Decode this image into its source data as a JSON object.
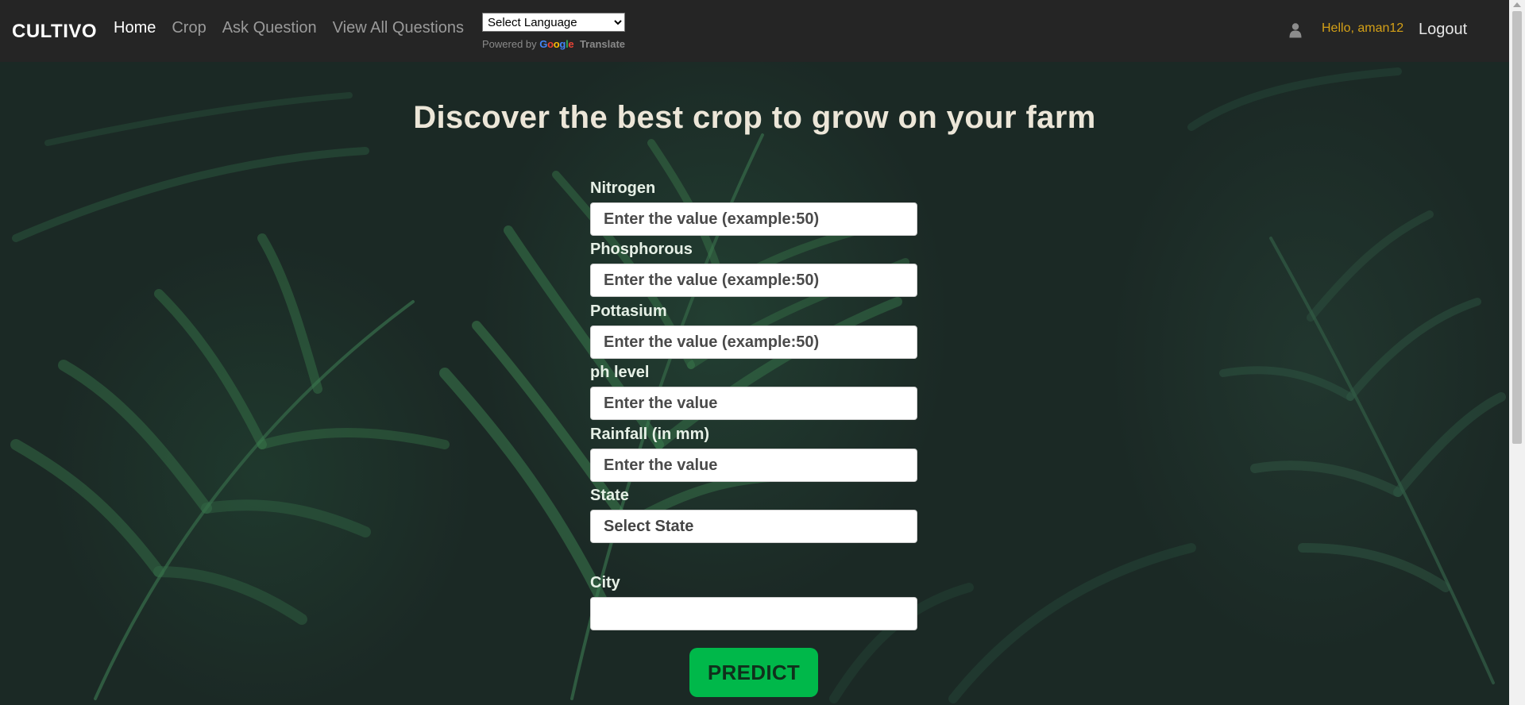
{
  "navbar": {
    "brand": "CULTIVO",
    "links": [
      "Home",
      "Crop",
      "Ask Question",
      "View All Questions"
    ],
    "active_index": 0,
    "translate": {
      "select_label": "Select Language",
      "powered_by": "Powered by",
      "google": "Google",
      "translate_word": "Translate"
    },
    "user_icon": "user-icon",
    "greeting": "Hello, aman12",
    "logout_label": "Logout"
  },
  "main": {
    "heading": "Discover the best crop to grow on your farm",
    "fields": {
      "nitrogen": {
        "label": "Nitrogen",
        "placeholder": "Enter the value (example:50)",
        "value": ""
      },
      "phosphorous": {
        "label": "Phosphorous",
        "placeholder": "Enter the value (example:50)",
        "value": ""
      },
      "pottasium": {
        "label": "Pottasium",
        "placeholder": "Enter the value (example:50)",
        "value": ""
      },
      "ph": {
        "label": "ph level",
        "placeholder": "Enter the value",
        "value": ""
      },
      "rainfall": {
        "label": "Rainfall (in mm)",
        "placeholder": "Enter the value",
        "value": ""
      },
      "state": {
        "label": "State",
        "selected": "Select State"
      },
      "city": {
        "label": "City",
        "value": ""
      }
    },
    "predict_label": "PREDICT"
  },
  "colors": {
    "navbar_bg": "#252525",
    "greeting": "#d4a017",
    "predict_button": "#00b84a",
    "heading_text": "#ece6d8"
  }
}
